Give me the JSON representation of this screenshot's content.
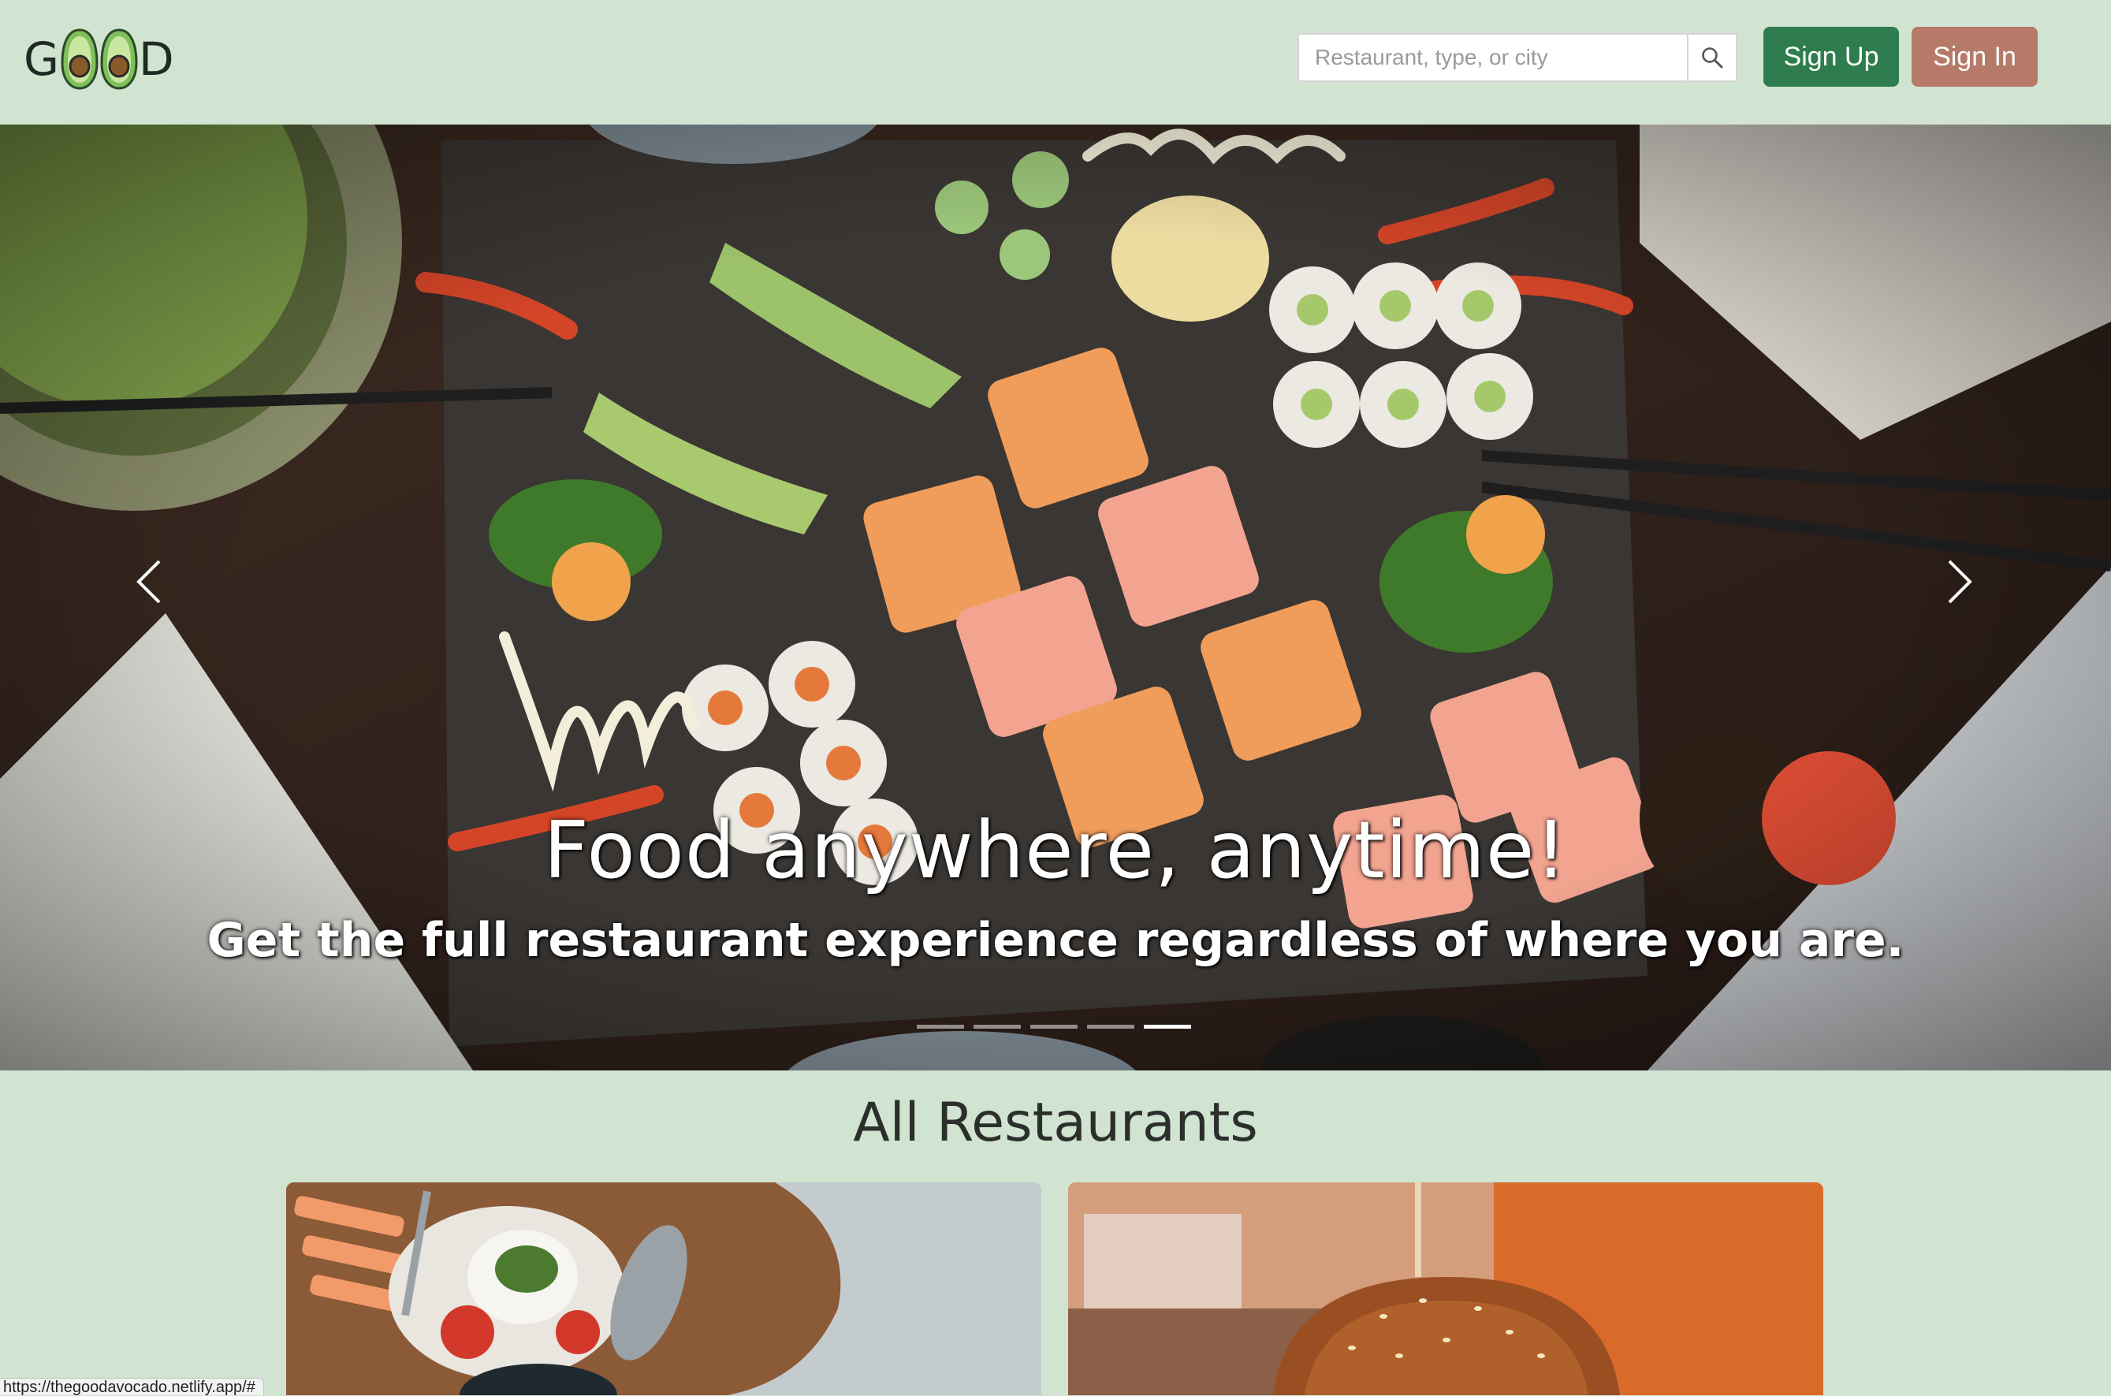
{
  "navbar": {
    "logo_letters": [
      "G",
      "D"
    ],
    "search": {
      "placeholder": "Restaurant, type, or city",
      "value": ""
    },
    "signup_label": "Sign Up",
    "signin_label": "Sign In"
  },
  "hero": {
    "title": "Food anywhere, anytime!",
    "subtitle": "Get the full restaurant experience regardless of where you are.",
    "slide_count": 5,
    "active_slide": 5
  },
  "restaurants": {
    "heading": "All Restaurants"
  },
  "status_bar": {
    "url": "https://thegoodavocado.netlify.app/#"
  },
  "colors": {
    "background": "#d1e3d1",
    "signup": "#2f7d4e",
    "signin": "#b67a68"
  },
  "icons": {
    "search": "search-icon",
    "prev": "chevron-left-icon",
    "next": "chevron-right-icon"
  }
}
